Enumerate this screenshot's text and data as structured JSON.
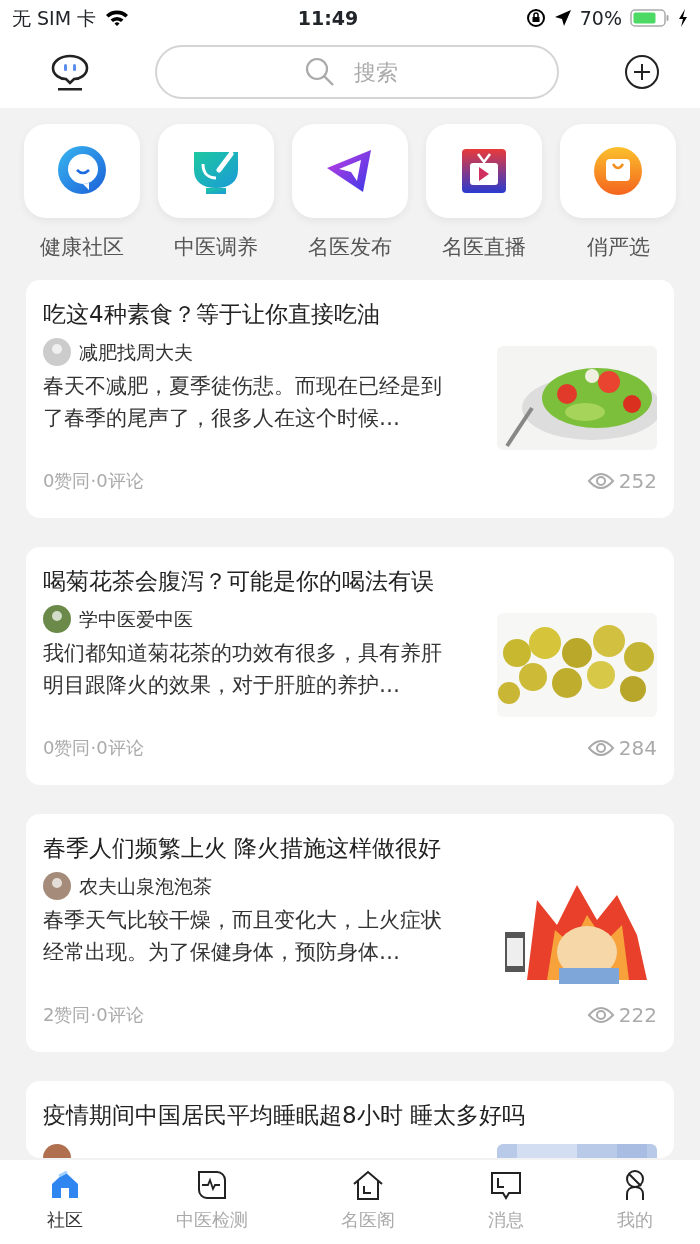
{
  "status_bar": {
    "carrier": "无 SIM 卡",
    "time": "11:49",
    "battery": "70%"
  },
  "header": {
    "search": {
      "placeholder": "搜索"
    }
  },
  "shortcuts": [
    {
      "label": "健康社区"
    },
    {
      "label": "中医调养"
    },
    {
      "label": "名医发布"
    },
    {
      "label": "名医直播"
    },
    {
      "label": "俏严选"
    }
  ],
  "articles": [
    {
      "kind": "full",
      "title": "吃这4种素食？等于让你直接吃油",
      "author": "减肥找周大夫",
      "snippet": "春天不减肥，夏季徒伤悲。而现在已经是到了春季的尾声了，很多人在这个时候…",
      "stats": "0赞同·0评论",
      "views": "252"
    },
    {
      "kind": "full",
      "title": "喝菊花茶会腹泻？可能是你的喝法有误",
      "author": "学中医爱中医",
      "snippet": "我们都知道菊花茶的功效有很多，具有养肝明目跟降火的效果，对于肝脏的养护…",
      "stats": "0赞同·0评论",
      "views": "284"
    },
    {
      "kind": "full",
      "title": "春季人们频繁上火 降火措施这样做很好",
      "author": "农夫山泉泡泡茶",
      "snippet": "春季天气比较干燥，而且变化大，上火症状经常出现。为了保健身体，预防身体…",
      "stats": "2赞同·0评论",
      "views": "222"
    },
    {
      "kind": "cut",
      "title": "疫情期间中国居民平均睡眠超8小时 睡太多好吗"
    }
  ],
  "tabs": [
    {
      "label": "社区",
      "selected": true
    },
    {
      "label": "中医检测",
      "selected": false
    },
    {
      "label": "名医阁",
      "selected": false
    },
    {
      "label": "消息",
      "selected": false
    },
    {
      "label": "我的",
      "selected": false
    }
  ]
}
